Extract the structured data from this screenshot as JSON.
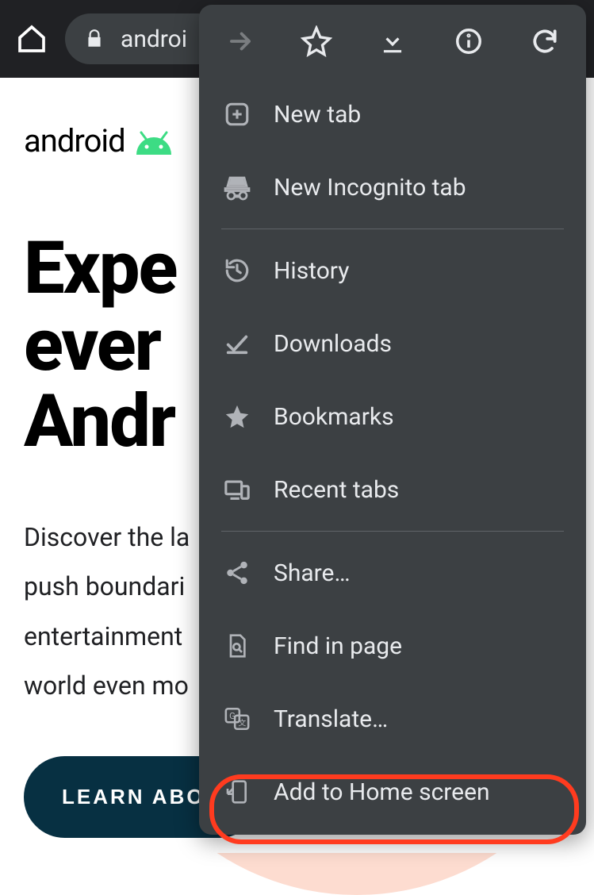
{
  "toolbar": {
    "url_text": "androi"
  },
  "page": {
    "logo_text": "android",
    "hero_line1": "Expe",
    "hero_line2": "ever",
    "hero_line3": "Andr",
    "sub_line1": "Discover the la",
    "sub_line2": "push boundari",
    "sub_line3": "entertainment",
    "sub_line4": "world even mo",
    "learn_button": "LEARN ABOU"
  },
  "menu": {
    "items": {
      "new_tab": "New tab",
      "incognito": "New Incognito tab",
      "history": "History",
      "downloads": "Downloads",
      "bookmarks": "Bookmarks",
      "recent_tabs": "Recent tabs",
      "share": "Share…",
      "find": "Find in page",
      "translate": "Translate…",
      "add_home": "Add to Home screen"
    }
  }
}
